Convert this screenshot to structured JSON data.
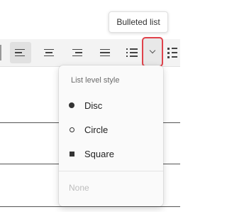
{
  "tooltip": {
    "text": "Bulleted list"
  },
  "toolbar": {
    "buttons": [
      "align-left",
      "align-center",
      "align-right",
      "justify",
      "bulleted-list",
      "numbered-list"
    ],
    "active": "align-left"
  },
  "menu": {
    "header": "List level style",
    "items": [
      {
        "label": "Disc",
        "marker": "disc"
      },
      {
        "label": "Circle",
        "marker": "circle"
      },
      {
        "label": "Square",
        "marker": "square"
      }
    ],
    "none_label": "None"
  },
  "colors": {
    "highlight_border": "#e0424b",
    "menu_bg": "#fafafa",
    "toolbar_bg": "#f3f3f3"
  }
}
